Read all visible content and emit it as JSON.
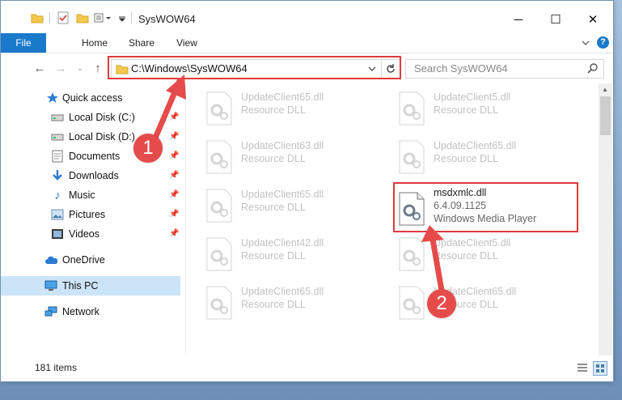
{
  "window": {
    "title": "SysWOW64",
    "controls": {
      "minimize": "─",
      "maximize": "☐",
      "close": "✕"
    }
  },
  "ribbon": {
    "tabs": [
      "File",
      "Home",
      "Share",
      "View"
    ],
    "collapse_icon": "chevron-down-icon",
    "help_icon": "help-icon"
  },
  "address": {
    "path": "C:\\Windows\\SysWOW64",
    "search_placeholder": "Search SysWOW64"
  },
  "nav": {
    "items": [
      {
        "label": "Quick access",
        "icon": "star-icon",
        "pinned": false
      },
      {
        "label": "Local Disk (C:)",
        "icon": "drive-icon",
        "pinned": true
      },
      {
        "label": "Local Disk (D:)",
        "icon": "drive-icon",
        "pinned": true
      },
      {
        "label": "Documents",
        "icon": "documents-icon",
        "pinned": true
      },
      {
        "label": "Downloads",
        "icon": "downloads-icon",
        "pinned": true
      },
      {
        "label": "Music",
        "icon": "music-icon",
        "pinned": true
      },
      {
        "label": "Pictures",
        "icon": "pictures-icon",
        "pinned": true
      },
      {
        "label": "Videos",
        "icon": "videos-icon",
        "pinned": true
      },
      {
        "label": "OneDrive",
        "icon": "cloud-icon",
        "pinned": false
      },
      {
        "label": "This PC",
        "icon": "pc-icon",
        "pinned": false,
        "selected": true
      },
      {
        "label": "Network",
        "icon": "network-icon",
        "pinned": false
      }
    ]
  },
  "files": [
    {
      "name": "UpdateClient65.dll",
      "type": "Resource DLL",
      "faded": true
    },
    {
      "name": "UpdateClient5.dll",
      "type": "Resource DLL",
      "faded": true
    },
    {
      "name": "UpdateClient63.dll",
      "type": "Resource DLL",
      "faded": true
    },
    {
      "name": "UpdateClient65.dll",
      "type": "Resource DLL",
      "faded": true
    },
    {
      "name": "UpdateClient65.dll",
      "type": "Resource DLL",
      "faded": true
    },
    {
      "name": "msdxmlc.dll",
      "version": "6.4.09.1125",
      "type": "Windows Media Player",
      "faded": false
    },
    {
      "name": "UpdateClient42.dll",
      "type": "Resource DLL",
      "faded": true
    },
    {
      "name": "UpdateClient5.dll",
      "type": "Resource DLL",
      "faded": true
    },
    {
      "name": "UpdateClient65.dll",
      "type": "Resource DLL",
      "faded": true
    },
    {
      "name": "UpdateClient65.dll",
      "type": "Resource DLL",
      "faded": true
    }
  ],
  "status": {
    "item_count": "181 items"
  },
  "annotations": {
    "step1": "1",
    "step2": "2",
    "color": "#e03a3e"
  }
}
